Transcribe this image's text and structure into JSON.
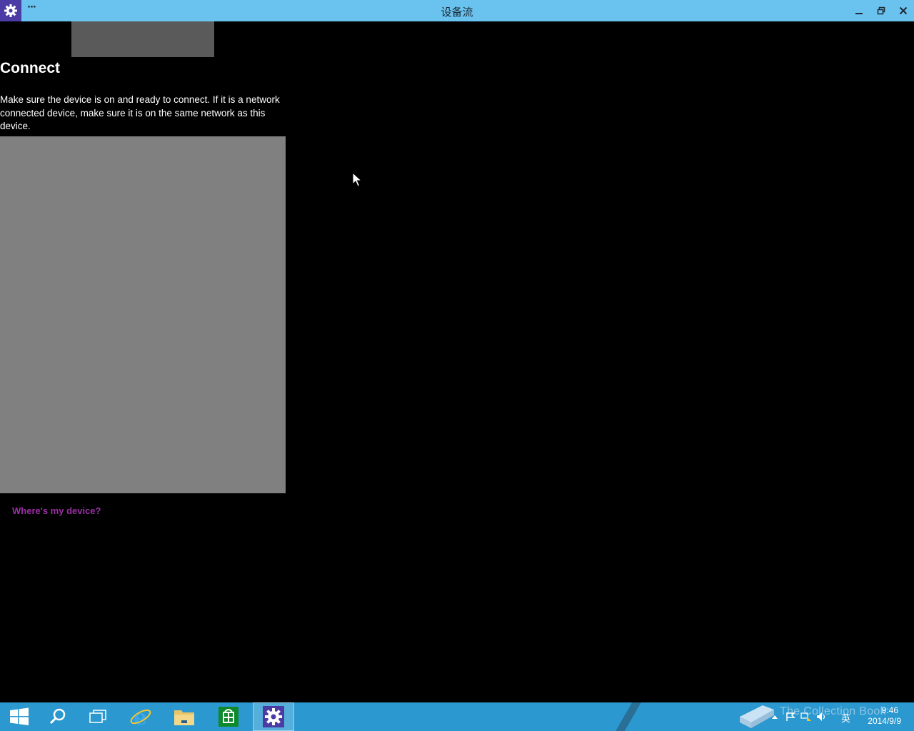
{
  "window": {
    "title": "设备流",
    "menu_label": "···",
    "controls": {
      "minimize": "minimize",
      "maximize": "restore",
      "close": "close"
    }
  },
  "main": {
    "heading": "Connect",
    "description": "Make sure the device is on and ready to connect. If it is a network connected device, make sure it is on the same network as this device.",
    "help_link": "Where's my device?"
  },
  "taskbar": {
    "pinned": [
      "start-icon",
      "search-icon",
      "task-view-icon",
      "internet-explorer-icon",
      "file-explorer-icon",
      "store-icon",
      "settings-icon"
    ],
    "active": "settings-icon",
    "tray": {
      "ime": "英",
      "time": "9:46",
      "date": "2014/9/9"
    },
    "watermark": "The Collection Book"
  },
  "colors": {
    "titlebar": "#6ac2ef",
    "taskbar": "#2b98cf",
    "app_icon_bg": "#4b3ba5",
    "link": "#9b2fa5",
    "panel": "#808080"
  }
}
